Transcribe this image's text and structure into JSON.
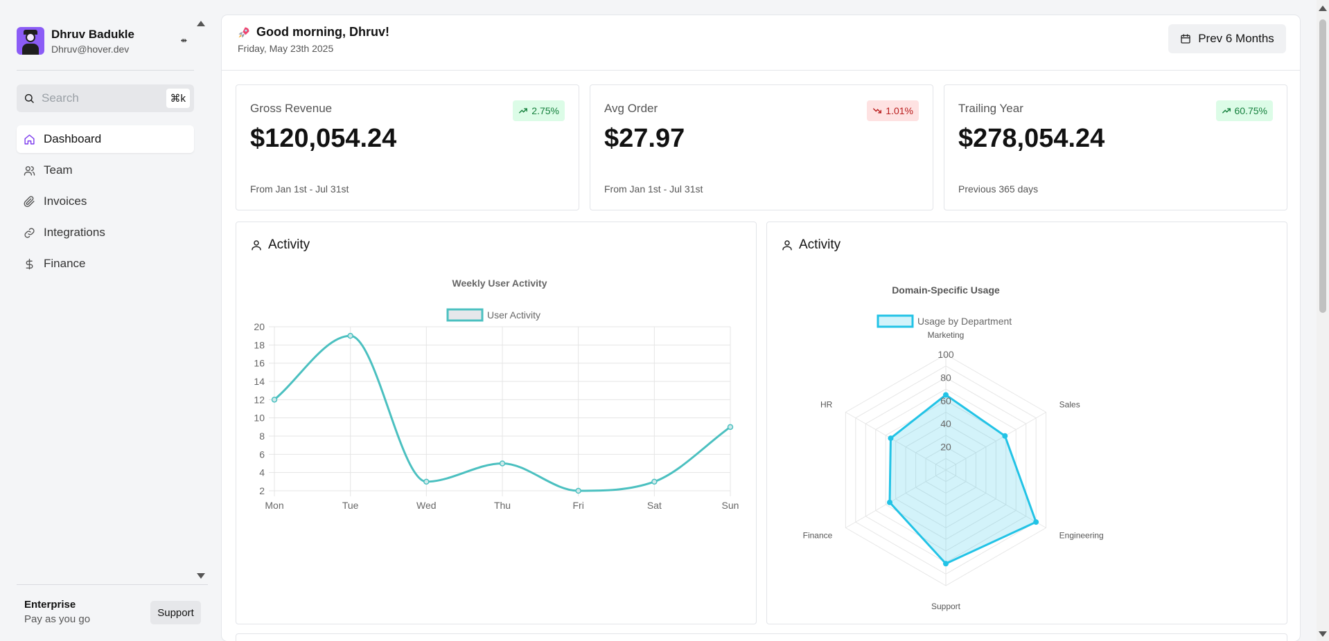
{
  "user": {
    "name": "Dhruv Badukle",
    "email": "Dhruv@hover.dev",
    "toggle_glyph": "⇼"
  },
  "search": {
    "placeholder": "Search",
    "shortcut": "⌘k"
  },
  "nav": {
    "items": [
      {
        "label": "Dashboard",
        "icon": "home-icon",
        "active": true
      },
      {
        "label": "Team",
        "icon": "users-icon"
      },
      {
        "label": "Invoices",
        "icon": "paperclip-icon"
      },
      {
        "label": "Integrations",
        "icon": "link-icon"
      },
      {
        "label": "Finance",
        "icon": "dollar-icon"
      }
    ]
  },
  "plan": {
    "name": "Enterprise",
    "subtitle": "Pay as you go",
    "support_label": "Support"
  },
  "header": {
    "greeting": "Good morning, Dhruv!",
    "date": "Friday, May 23th 2025",
    "period_label": "Prev 6 Months"
  },
  "stats": [
    {
      "label": "Gross Revenue",
      "value": "$120,054.24",
      "change": "2.75%",
      "trend": "up",
      "sub": "From Jan 1st - Jul 31st"
    },
    {
      "label": "Avg Order",
      "value": "$27.97",
      "change": "1.01%",
      "trend": "down",
      "sub": "From Jan 1st - Jul 31st"
    },
    {
      "label": "Trailing Year",
      "value": "$278,054.24",
      "change": "60.75%",
      "trend": "up",
      "sub": "Previous 365 days"
    }
  ],
  "activity_cards": [
    {
      "title": "Activity"
    },
    {
      "title": "Activity"
    }
  ],
  "colors": {
    "line": "#4bc0c0",
    "radar": "#22c3e6",
    "accent": "#7c3aed"
  },
  "chart_data": [
    {
      "type": "line",
      "title": "Weekly User Activity",
      "categories": [
        "Mon",
        "Tue",
        "Wed",
        "Thu",
        "Fri",
        "Sat",
        "Sun"
      ],
      "series": [
        {
          "name": "User Activity",
          "values": [
            12,
            19,
            3,
            5,
            2,
            3,
            9
          ]
        }
      ],
      "ylim": [
        2,
        20
      ],
      "yticks": [
        2,
        4,
        6,
        8,
        10,
        12,
        14,
        16,
        18,
        20
      ],
      "legend": "top",
      "grid": true
    },
    {
      "type": "radar",
      "title": "Domain-Specific Usage",
      "categories": [
        "Marketing",
        "Sales",
        "Engineering",
        "Support",
        "Finance",
        "HR"
      ],
      "series": [
        {
          "name": "Usage by Department",
          "values": [
            65,
            59,
            90,
            81,
            56,
            55
          ]
        }
      ],
      "rlim": [
        0,
        100
      ],
      "rticks": [
        20,
        40,
        60,
        80,
        100
      ],
      "legend": "top"
    }
  ]
}
